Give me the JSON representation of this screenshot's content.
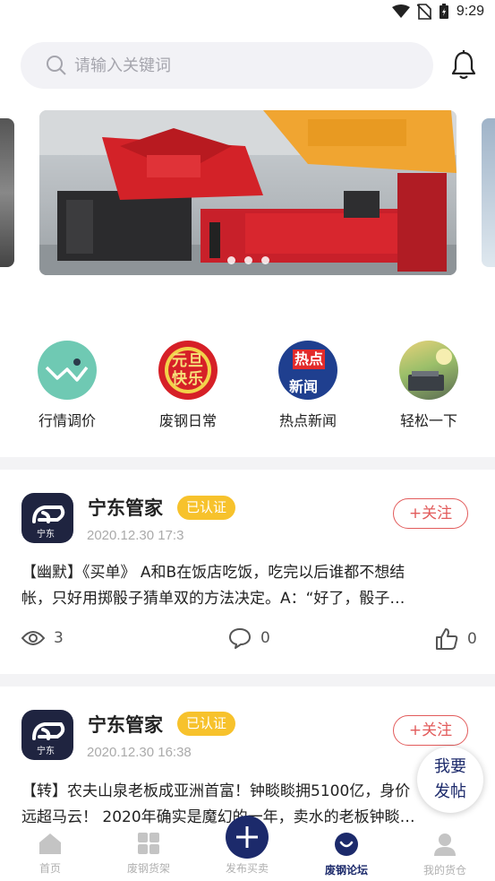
{
  "status_bar": {
    "time": "9:29"
  },
  "search": {
    "placeholder": "请输入关键词"
  },
  "quick_nav": [
    {
      "label": "行情调价",
      "icon": "trend-icon"
    },
    {
      "label": "废钢日常",
      "icon": "new-year-icon",
      "art_text": "元旦快乐"
    },
    {
      "label": "热点新闻",
      "icon": "hot-news-icon",
      "art_top": "热点",
      "art_bottom": "新闻"
    },
    {
      "label": "轻松一下",
      "icon": "relax-icon"
    }
  ],
  "posts": [
    {
      "author": "宁东管家",
      "verified": "已认证",
      "date": "2020.12.30 17:3",
      "follow": "+关注",
      "line1": "【幽默】《买单》 A和B在饭店吃饭，吃完以后谁都不想结",
      "line2": "帐，只好用掷骰子猜单双的方法决定。A：“好了，骰子…",
      "views": "3",
      "comments": "0",
      "likes": "0"
    },
    {
      "author": "宁东管家",
      "verified": "已认证",
      "date": "2020.12.30 16:38",
      "follow": "+关注",
      "line1": "【转】农夫山泉老板成亚洲首富！钟睒睒拥5100亿，身价",
      "line2": "远超马云！ 2020年确实是魔幻的一年，卖水的老板钟睒…"
    }
  ],
  "avatar_text": "宁东",
  "fab": {
    "line1": "我要",
    "line2": "发帖"
  },
  "bottom_nav": [
    {
      "label": "首页",
      "icon": "home-icon"
    },
    {
      "label": "废钢货架",
      "icon": "grid-icon"
    },
    {
      "label": "发布买卖",
      "icon": "plus-icon"
    },
    {
      "label": "废钢论坛",
      "icon": "forum-icon",
      "active": true
    },
    {
      "label": "我的货仓",
      "icon": "user-icon"
    }
  ],
  "colors": {
    "accent": "#1c2a6b",
    "badge": "#f7c22c",
    "follow": "#e25b5b"
  }
}
